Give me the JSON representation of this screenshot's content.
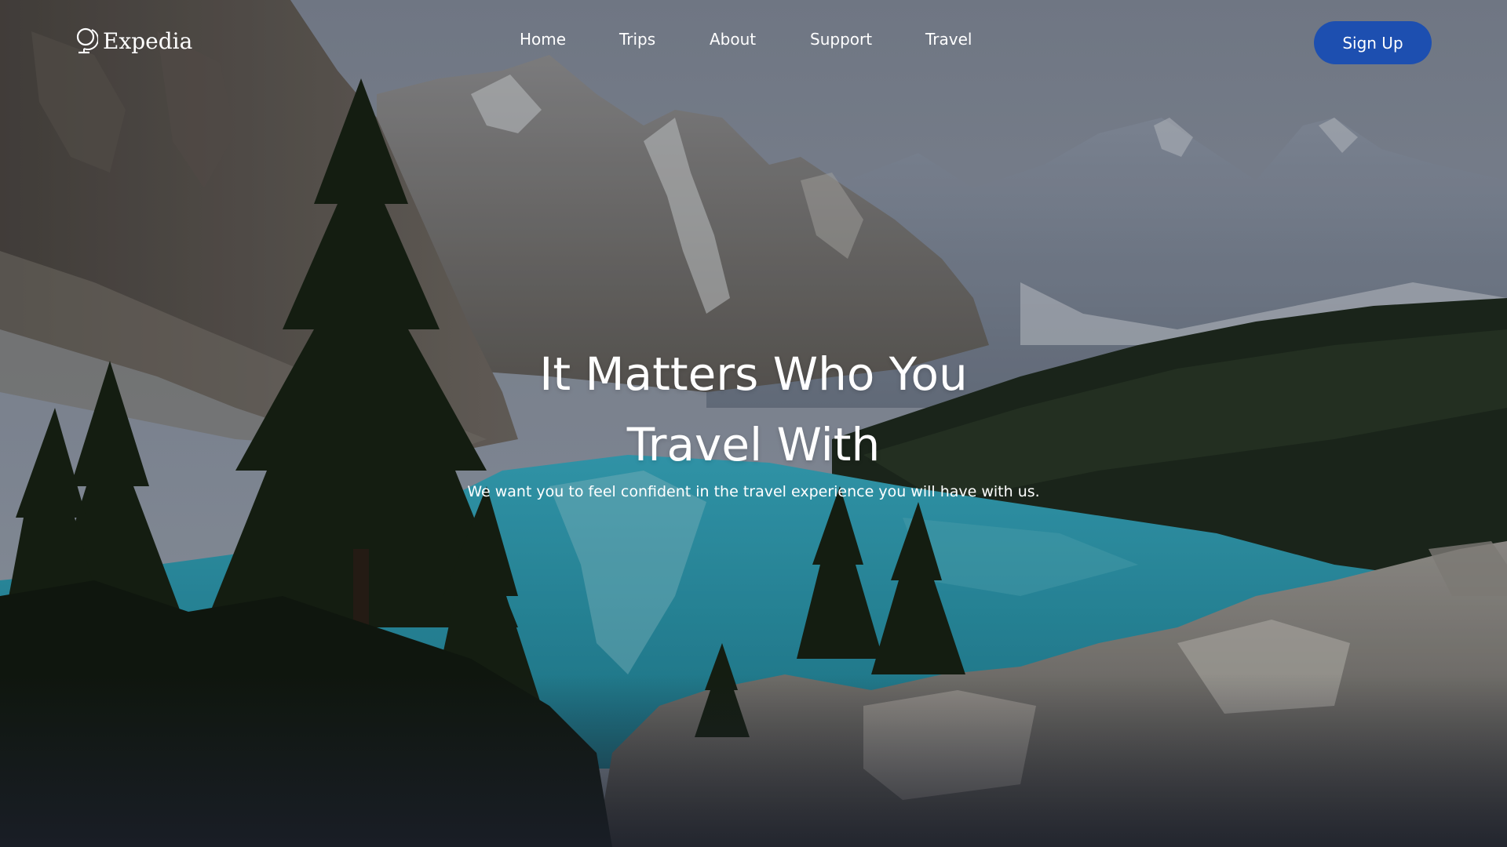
{
  "brand": {
    "name": "Expedia",
    "icon": "globe-icon"
  },
  "nav": {
    "items": [
      {
        "label": "Home"
      },
      {
        "label": "Trips"
      },
      {
        "label": "About"
      },
      {
        "label": "Support"
      },
      {
        "label": "Travel"
      }
    ],
    "signup_label": "Sign Up"
  },
  "hero": {
    "headline_line1": "It Matters Who You",
    "headline_line2": "Travel With",
    "subtitle": "We want you to feel confident in the travel experience you will have with us."
  },
  "colors": {
    "accent": "#1d4fb0",
    "text": "#ffffff",
    "lake": "#2aa3bf",
    "forest": "#1c2b1c"
  }
}
